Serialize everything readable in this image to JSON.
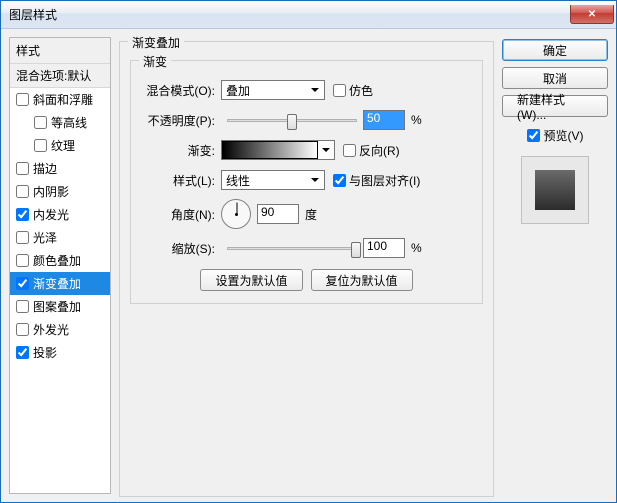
{
  "window": {
    "title": "图层样式"
  },
  "styleList": {
    "header": "样式",
    "blend": "混合选项:默认",
    "items": [
      {
        "label": "斜面和浮雕",
        "checked": false
      },
      {
        "label": "等高线",
        "checked": false,
        "indent": true
      },
      {
        "label": "纹理",
        "checked": false,
        "indent": true
      },
      {
        "label": "描边",
        "checked": false
      },
      {
        "label": "内阴影",
        "checked": false
      },
      {
        "label": "内发光",
        "checked": true
      },
      {
        "label": "光泽",
        "checked": false
      },
      {
        "label": "颜色叠加",
        "checked": false
      },
      {
        "label": "渐变叠加",
        "checked": true,
        "selected": true
      },
      {
        "label": "图案叠加",
        "checked": false
      },
      {
        "label": "外发光",
        "checked": false
      },
      {
        "label": "投影",
        "checked": true
      }
    ]
  },
  "group": {
    "title": "渐变叠加",
    "sub": "渐变"
  },
  "form": {
    "blendMode": {
      "label": "混合模式(O):",
      "value": "叠加",
      "dither": "仿色"
    },
    "opacity": {
      "label": "不透明度(P):",
      "value": "50",
      "unit": "%"
    },
    "gradient": {
      "label": "渐变:",
      "reverse": "反向(R)"
    },
    "style": {
      "label": "样式(L):",
      "value": "线性",
      "align": "与图层对齐(I)"
    },
    "angle": {
      "label": "角度(N):",
      "value": "90",
      "unit": "度"
    },
    "scale": {
      "label": "缩放(S):",
      "value": "100",
      "unit": "%"
    },
    "btnDefault": "设置为默认值",
    "btnReset": "复位为默认值"
  },
  "right": {
    "ok": "确定",
    "cancel": "取消",
    "newStyle": "新建样式(W)...",
    "preview": "预览(V)"
  }
}
